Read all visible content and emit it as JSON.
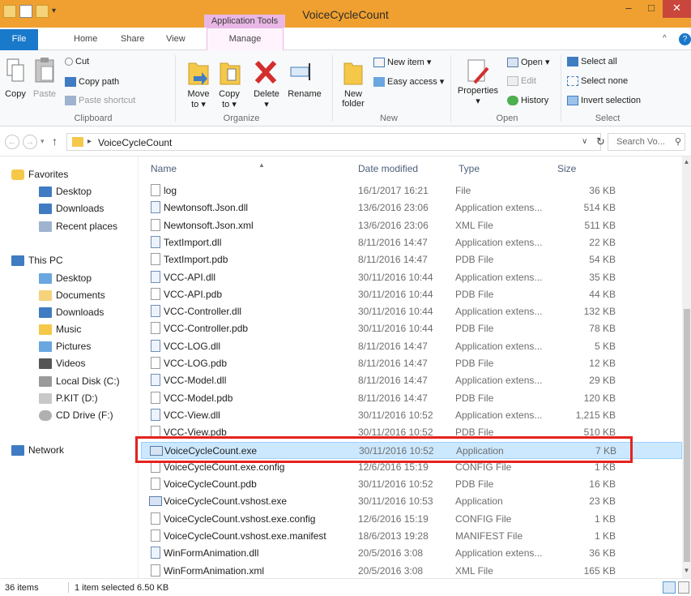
{
  "window": {
    "title": "VoiceCycleCount",
    "context_tab_label": "Application Tools",
    "minimize_glyph": "–",
    "maximize_glyph": "□",
    "close_glyph": "✕"
  },
  "tabs": {
    "file": "File",
    "home": "Home",
    "share": "Share",
    "view": "View",
    "manage": "Manage",
    "collapse_glyph": "^",
    "help_glyph": "?"
  },
  "ribbon": {
    "clipboard": {
      "label": "Clipboard",
      "copy": "Copy",
      "paste": "Paste",
      "cut": "Cut",
      "copy_path": "Copy path",
      "paste_shortcut": "Paste shortcut"
    },
    "organize": {
      "label": "Organize",
      "move_to": "Move",
      "move_to_2": "to ▾",
      "copy_to": "Copy",
      "copy_to_2": "to ▾",
      "delete": "Delete",
      "delete_2": "▾",
      "rename": "Rename"
    },
    "new": {
      "label": "New",
      "new_folder": "New",
      "new_folder_2": "folder",
      "new_item": "New item ▾",
      "easy_access": "Easy access ▾"
    },
    "open": {
      "label": "Open",
      "properties": "Properties",
      "properties_2": "▾",
      "open": "Open ▾",
      "edit": "Edit",
      "history": "History"
    },
    "select": {
      "label": "Select",
      "select_all": "Select all",
      "select_none": "Select none",
      "invert_selection": "Invert selection"
    }
  },
  "address": {
    "path_item": "VoiceCycleCount",
    "search_placeholder": "Search Vo..."
  },
  "navigation": {
    "favorites": "Favorites",
    "desktop_fav": "Desktop",
    "downloads_fav": "Downloads",
    "recent_places": "Recent places",
    "this_pc": "This PC",
    "desktop": "Desktop",
    "documents": "Documents",
    "downloads": "Downloads",
    "music": "Music",
    "pictures": "Pictures",
    "videos": "Videos",
    "local_disk": "Local Disk (C:)",
    "pkit": "P.KIT (D:)",
    "cd_drive": "CD Drive (F:)",
    "network": "Network"
  },
  "columns": {
    "name": "Name",
    "date_modified": "Date modified",
    "type": "Type",
    "size": "Size"
  },
  "files": [
    {
      "name": "log",
      "date": "16/1/2017 16:21",
      "type": "File",
      "size": "36 KB",
      "kind": "file"
    },
    {
      "name": "Newtonsoft.Json.dll",
      "date": "13/6/2016 23:06",
      "type": "Application extens...",
      "size": "514 KB",
      "kind": "dll"
    },
    {
      "name": "Newtonsoft.Json.xml",
      "date": "13/6/2016 23:06",
      "type": "XML File",
      "size": "511 KB",
      "kind": "file"
    },
    {
      "name": "TextImport.dll",
      "date": "8/11/2016 14:47",
      "type": "Application extens...",
      "size": "22 KB",
      "kind": "dll"
    },
    {
      "name": "TextImport.pdb",
      "date": "8/11/2016 14:47",
      "type": "PDB File",
      "size": "54 KB",
      "kind": "file"
    },
    {
      "name": "VCC-API.dll",
      "date": "30/11/2016 10:44",
      "type": "Application extens...",
      "size": "35 KB",
      "kind": "dll"
    },
    {
      "name": "VCC-API.pdb",
      "date": "30/11/2016 10:44",
      "type": "PDB File",
      "size": "44 KB",
      "kind": "file"
    },
    {
      "name": "VCC-Controller.dll",
      "date": "30/11/2016 10:44",
      "type": "Application extens...",
      "size": "132 KB",
      "kind": "dll"
    },
    {
      "name": "VCC-Controller.pdb",
      "date": "30/11/2016 10:44",
      "type": "PDB File",
      "size": "78 KB",
      "kind": "file"
    },
    {
      "name": "VCC-LOG.dll",
      "date": "8/11/2016 14:47",
      "type": "Application extens...",
      "size": "5 KB",
      "kind": "dll"
    },
    {
      "name": "VCC-LOG.pdb",
      "date": "8/11/2016 14:47",
      "type": "PDB File",
      "size": "12 KB",
      "kind": "file"
    },
    {
      "name": "VCC-Model.dll",
      "date": "8/11/2016 14:47",
      "type": "Application extens...",
      "size": "29 KB",
      "kind": "dll"
    },
    {
      "name": "VCC-Model.pdb",
      "date": "8/11/2016 14:47",
      "type": "PDB File",
      "size": "120 KB",
      "kind": "file"
    },
    {
      "name": "VCC-View.dll",
      "date": "30/11/2016 10:52",
      "type": "Application extens...",
      "size": "1,215 KB",
      "kind": "dll"
    },
    {
      "name": "VCC-View.pdb",
      "date": "30/11/2016 10:52",
      "type": "PDB File",
      "size": "510 KB",
      "kind": "file"
    },
    {
      "name": "VoiceCycleCount.exe",
      "date": "30/11/2016 10:52",
      "type": "Application",
      "size": "7 KB",
      "kind": "exe"
    },
    {
      "name": "VoiceCycleCount.exe.config",
      "date": "12/6/2016 15:19",
      "type": "CONFIG File",
      "size": "1 KB",
      "kind": "file"
    },
    {
      "name": "VoiceCycleCount.pdb",
      "date": "30/11/2016 10:52",
      "type": "PDB File",
      "size": "16 KB",
      "kind": "file"
    },
    {
      "name": "VoiceCycleCount.vshost.exe",
      "date": "30/11/2016 10:53",
      "type": "Application",
      "size": "23 KB",
      "kind": "exe"
    },
    {
      "name": "VoiceCycleCount.vshost.exe.config",
      "date": "12/6/2016 15:19",
      "type": "CONFIG File",
      "size": "1 KB",
      "kind": "file"
    },
    {
      "name": "VoiceCycleCount.vshost.exe.manifest",
      "date": "18/6/2013 19:28",
      "type": "MANIFEST File",
      "size": "1 KB",
      "kind": "file"
    },
    {
      "name": "WinFormAnimation.dll",
      "date": "20/5/2016 3:08",
      "type": "Application extens...",
      "size": "36 KB",
      "kind": "dll"
    },
    {
      "name": "WinFormAnimation.xml",
      "date": "20/5/2016 3:08",
      "type": "XML File",
      "size": "165 KB",
      "kind": "file"
    }
  ],
  "selected_index": 15,
  "status": {
    "item_count": "36 items",
    "selection": "1 item selected  6.50 KB"
  },
  "colors": {
    "titlebar": "#f0a030",
    "file_tab": "#1979ca",
    "selection": "#cce8ff",
    "highlight_box": "#e4231f"
  }
}
